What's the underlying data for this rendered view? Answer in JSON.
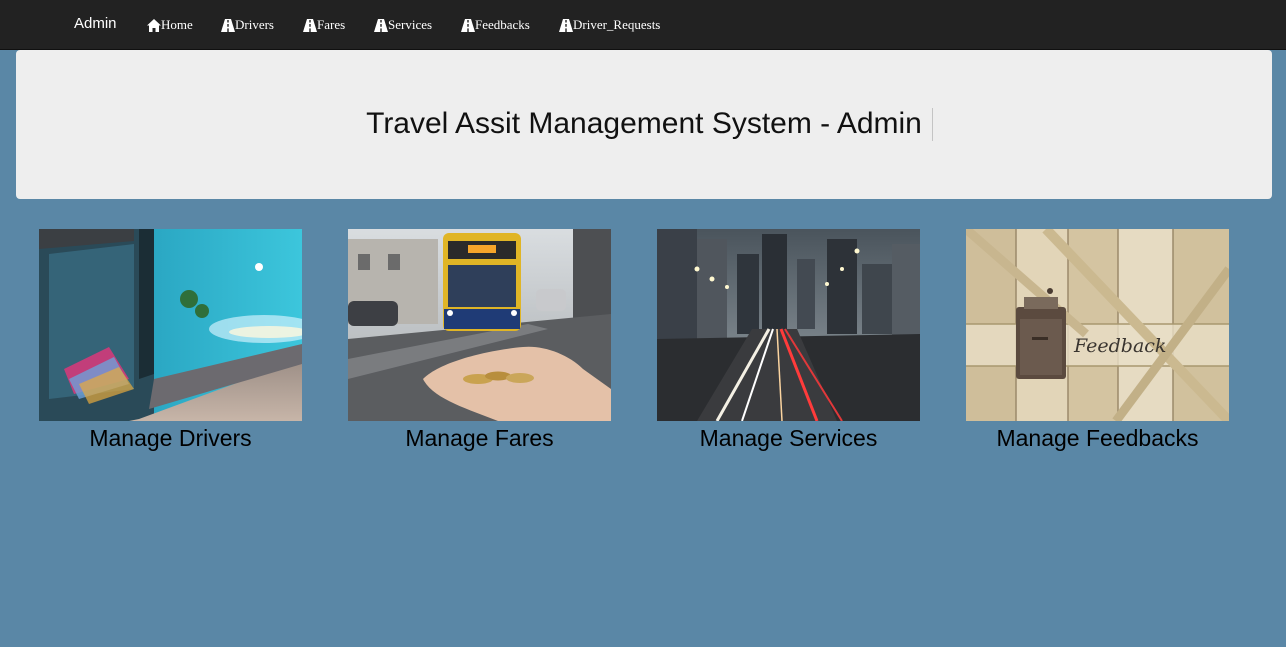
{
  "navbar": {
    "brand": "Admin",
    "items": [
      {
        "label": "Home",
        "icon": "home-icon"
      },
      {
        "label": "Drivers",
        "icon": "road-icon"
      },
      {
        "label": "Fares",
        "icon": "road-icon"
      },
      {
        "label": "Services",
        "icon": "road-icon"
      },
      {
        "label": "Feedbacks",
        "icon": "road-icon"
      },
      {
        "label": "Driver_Requests",
        "icon": "road-icon"
      }
    ]
  },
  "jumbotron": {
    "title": "Travel Assit Management System - Admin"
  },
  "cards": [
    {
      "caption": "Manage Drivers",
      "image": "bus-stop-photo"
    },
    {
      "caption": "Manage Fares",
      "image": "coins-in-hand-photo"
    },
    {
      "caption": "Manage Services",
      "image": "city-traffic-photo"
    },
    {
      "caption": "Manage Feedbacks",
      "image": "feedback-mailbox-photo"
    }
  ],
  "colors": {
    "background": "#5a87a6",
    "navbar": "#222222",
    "jumbotron": "#eeeeee"
  }
}
